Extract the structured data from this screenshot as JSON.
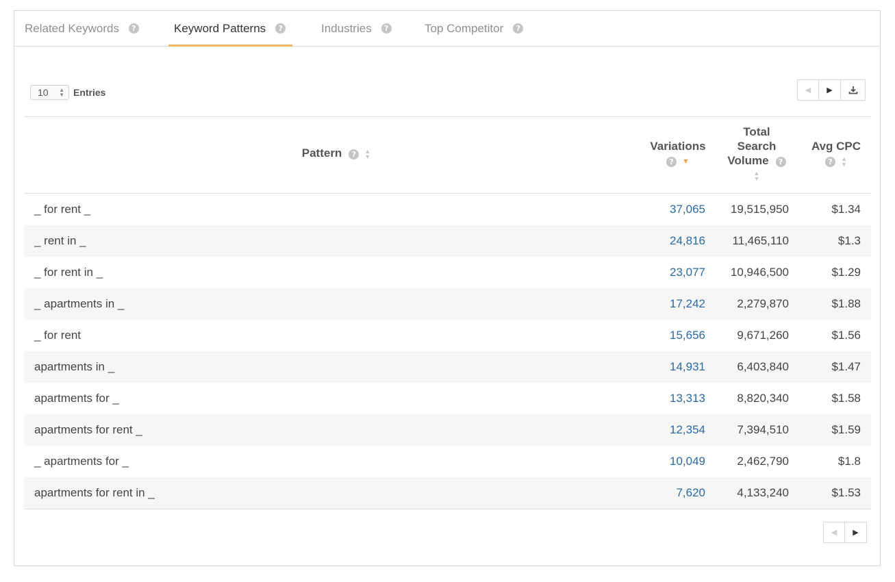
{
  "tabs": [
    {
      "label": "Related Keywords",
      "active": false
    },
    {
      "label": "Keyword Patterns",
      "active": true
    },
    {
      "label": "Industries",
      "active": false
    },
    {
      "label": "Top Competitor",
      "active": false
    }
  ],
  "entries": {
    "value": "10",
    "label": "Entries"
  },
  "icons": {
    "help": "question-circle-icon",
    "prev": "chevron-left-icon",
    "next": "chevron-right-icon",
    "download": "download-icon",
    "sort": "sort-icon"
  },
  "table": {
    "columns": {
      "pattern": "Pattern",
      "variations": "Variations",
      "volume_line1": "Total",
      "volume_line2": "Search",
      "volume_line3": "Volume",
      "cpc": "Avg CPC"
    },
    "sorted_by": "Variations",
    "rows": [
      {
        "pattern": "_ for rent _",
        "variations": "37,065",
        "volume": "19,515,950",
        "cpc": "$1.34"
      },
      {
        "pattern": "_ rent in _",
        "variations": "24,816",
        "volume": "11,465,110",
        "cpc": "$1.3"
      },
      {
        "pattern": "_ for rent in _",
        "variations": "23,077",
        "volume": "10,946,500",
        "cpc": "$1.29"
      },
      {
        "pattern": "_ apartments in _",
        "variations": "17,242",
        "volume": "2,279,870",
        "cpc": "$1.88"
      },
      {
        "pattern": "_ for rent",
        "variations": "15,656",
        "volume": "9,671,260",
        "cpc": "$1.56"
      },
      {
        "pattern": "apartments in _",
        "variations": "14,931",
        "volume": "6,403,840",
        "cpc": "$1.47"
      },
      {
        "pattern": "apartments for _",
        "variations": "13,313",
        "volume": "8,820,340",
        "cpc": "$1.58"
      },
      {
        "pattern": "apartments for rent _",
        "variations": "12,354",
        "volume": "7,394,510",
        "cpc": "$1.59"
      },
      {
        "pattern": "_ apartments for _",
        "variations": "10,049",
        "volume": "2,462,790",
        "cpc": "$1.8"
      },
      {
        "pattern": "apartments for rent in _",
        "variations": "7,620",
        "volume": "4,133,240",
        "cpc": "$1.53"
      }
    ]
  },
  "colors": {
    "accent": "#f0b760",
    "link": "#2a6aa8",
    "row_stripe": "#f6f6f6"
  }
}
